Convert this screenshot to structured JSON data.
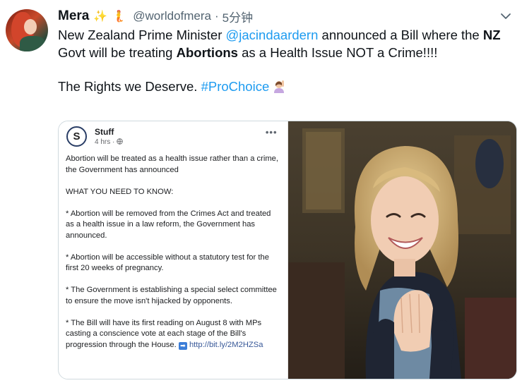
{
  "tweet": {
    "display_name": "Mera",
    "emoji_1": "✨",
    "emoji_2": "🧜",
    "handle": "@worldofmera",
    "separator": "·",
    "time": "5分钟",
    "text_part1": "New Zealand Prime Minister ",
    "mention": "@jacindaardern",
    "text_part2": " announced a Bill where the ",
    "bold_1": "NZ",
    "text_part3": " Govt will be treating ",
    "bold_2": "Abortions",
    "text_part4": " as a Health Issue NOT a Crime!!!!",
    "line2_text": "The Rights we Deserve. ",
    "hashtag": "#ProChoice",
    "menu_icon": "chevron-down-icon",
    "colors": {
      "link": "#1d9bf0",
      "handle_gray": "#536471"
    }
  },
  "embedded_post": {
    "page_name": "Stuff",
    "logo_letter": "S",
    "meta_time": "4 hrs",
    "meta_sep": "·",
    "meta_icon": "globe-icon",
    "menu_dots": "•••",
    "paragraphs": [
      "Abortion will be treated as a health issue rather than a crime, the Government has announced",
      "WHAT YOU NEED TO KNOW:",
      "* Abortion will be removed from the Crimes Act and treated as a health issue in a law reform, the Government has announced.",
      "* Abortion will be accessible without a statutory test for the first 20 weeks of pregnancy.",
      "* The Government is establishing a special select committee to ensure the move isn't hijacked by opponents."
    ],
    "last_paragraph_text": "* The Bill will have its first reading on August 8 with MPs casting a conscience vote at each stage of the Bill's progression through the House. ",
    "arrow_glyph": "➡",
    "url": "http://bit.ly/2M2HZSa"
  },
  "photo": {
    "subject": "smiling woman clapping hands"
  }
}
